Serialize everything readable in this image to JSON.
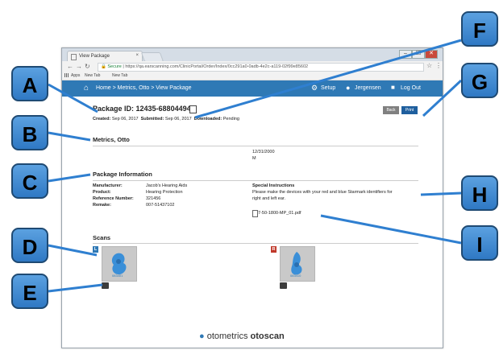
{
  "browser": {
    "tab_title": "View Package",
    "tab_close": "×",
    "win_min": "–",
    "win_max": "☐",
    "win_close": "✕",
    "secure_label": "Secure",
    "url": "https://qa.earscanning.com/ClinicPortal/Order/Index/0cc291a0-0adb-4e2c-a119-02f99e85602",
    "bookmarks": {
      "apps": "Apps",
      "newtab1": "New Tab",
      "newtab2": "New Tab"
    }
  },
  "app_header": {
    "breadcrumb": "Home > Metrics, Otto > View Package",
    "setup": "Setup",
    "user": "Jergensen",
    "logout": "Log Out"
  },
  "package": {
    "id_label": "Package ID: 12435-68804494",
    "created_label": "Created:",
    "created": "Sep 06, 2017",
    "submitted_label": "Submitted:",
    "submitted": "Sep 06, 2017",
    "downloaded_label": "Downloaded:",
    "downloaded": "Pending",
    "back_button": "Back",
    "print_button": "Print"
  },
  "patient": {
    "name": "Metrics, Otto",
    "dob": "12/31/2000",
    "gender": "M"
  },
  "package_info": {
    "heading": "Package Information",
    "manufacturer_label": "Manufacturer:",
    "manufacturer": "Jacob's Hearing Aids",
    "product_label": "Product:",
    "product": "Hearing Protection",
    "reference_label": "Reference Number:",
    "reference": "321456",
    "remake_label": "Remake:",
    "remake": "007-51437102",
    "special_heading": "Special Instructions",
    "special_text_1": "Please make the devices with your red and blue Starmark identifiers for",
    "special_text_2": "right and left ear.",
    "attachment": "7-50-1800-MP_01.pdf"
  },
  "scans": {
    "heading": "Scans",
    "left_badge": "L",
    "right_badge": "R",
    "left_scan_id": "083401",
    "right_scan_id": "083410"
  },
  "footer": {
    "brand1": "otometrics",
    "brand2": "otoscan"
  },
  "callouts": {
    "A": "A",
    "B": "B",
    "C": "C",
    "D": "D",
    "E": "E",
    "F": "F",
    "G": "G",
    "H": "H",
    "I": "I"
  },
  "colors": {
    "header_blue": "#2f79b5",
    "callout_blue": "#3d8bd6",
    "line_blue": "#2f7fd0",
    "back_gray": "#808080",
    "print_blue": "#1f5f9e",
    "left_badge": "#2f79b5",
    "right_badge": "#c0392b"
  }
}
